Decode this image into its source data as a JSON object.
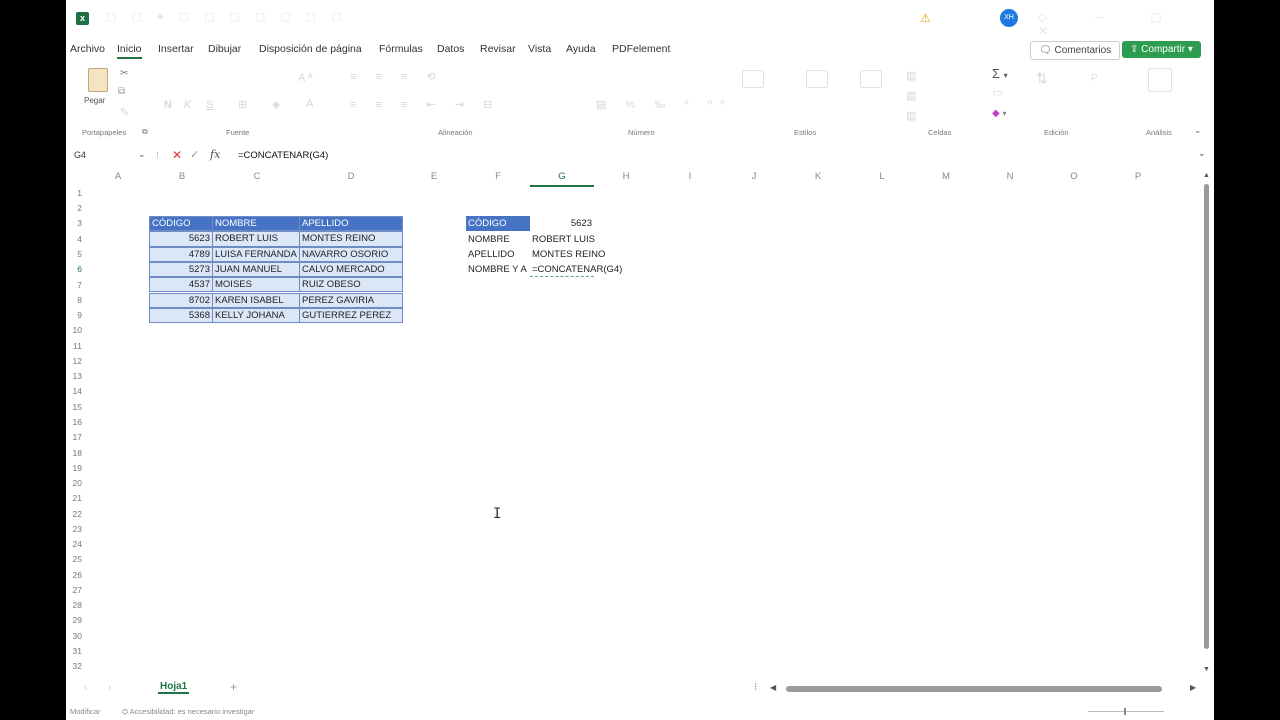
{
  "menu": {
    "items": [
      "Archivo",
      "Inicio",
      "Insertar",
      "Dibujar",
      "Disposición de página",
      "Fórmulas",
      "Datos",
      "Revisar",
      "Vista",
      "Ayuda",
      "PDFelement"
    ],
    "comments_label": "Comentarios",
    "share_label": "Compartir"
  },
  "account": {
    "initials": "XH"
  },
  "ribbon": {
    "paste_label": "Pegar",
    "groups": [
      "Portapapeles",
      "Fuente",
      "Alineación",
      "Número",
      "Estilos",
      "Celdas",
      "Edición",
      "Análisis"
    ]
  },
  "formula_bar": {
    "name_box": "G4",
    "formula": "=CONCATENAR(G4)"
  },
  "columns": [
    "A",
    "B",
    "C",
    "D",
    "E",
    "F",
    "G",
    "H",
    "I",
    "J",
    "K",
    "L",
    "M",
    "N",
    "O",
    "P"
  ],
  "rows": [
    "1",
    "2",
    "3",
    "4",
    "5",
    "6",
    "7",
    "8",
    "9",
    "10",
    "11",
    "12",
    "13",
    "14",
    "15",
    "16",
    "17",
    "18",
    "19",
    "20",
    "21",
    "22",
    "23",
    "24",
    "25",
    "26",
    "27",
    "28",
    "29",
    "30",
    "31",
    "32"
  ],
  "table": {
    "headers": [
      "CÓDIGO",
      "NOMBRE",
      "APELLIDO"
    ],
    "rows": [
      [
        "5623",
        "ROBERT LUIS",
        "MONTES REINO"
      ],
      [
        "4789",
        "LUISA FERNANDA",
        "NAVARRO OSORIO"
      ],
      [
        "5273",
        "JUAN MANUEL",
        "CALVO MERCADO"
      ],
      [
        "4537",
        "MOISES",
        "RUIZ OBESO"
      ],
      [
        "8702",
        "KAREN ISABEL",
        "PEREZ GAVIRIA"
      ],
      [
        "5368",
        "KELLY JOHANA",
        "GUTIERREZ PEREZ"
      ]
    ]
  },
  "lookup": {
    "code_label": "CÓDIGO",
    "code_value": "5623",
    "name_label": "NOMBRE",
    "name_value": "ROBERT LUIS",
    "surname_label": "APELLIDO",
    "surname_value": "MONTES REINO",
    "full_label": "NOMBRE Y A",
    "full_formula": "=CONCATENAR(G4)"
  },
  "sheets": {
    "active": "Hoja1"
  },
  "status": {
    "mode": "Modificar",
    "accessibility": "Accesibilidad: es necesario investigar"
  },
  "colors": {
    "accent": "#217346",
    "table_header": "#4673c4",
    "table_body": "#dbe6f7"
  }
}
